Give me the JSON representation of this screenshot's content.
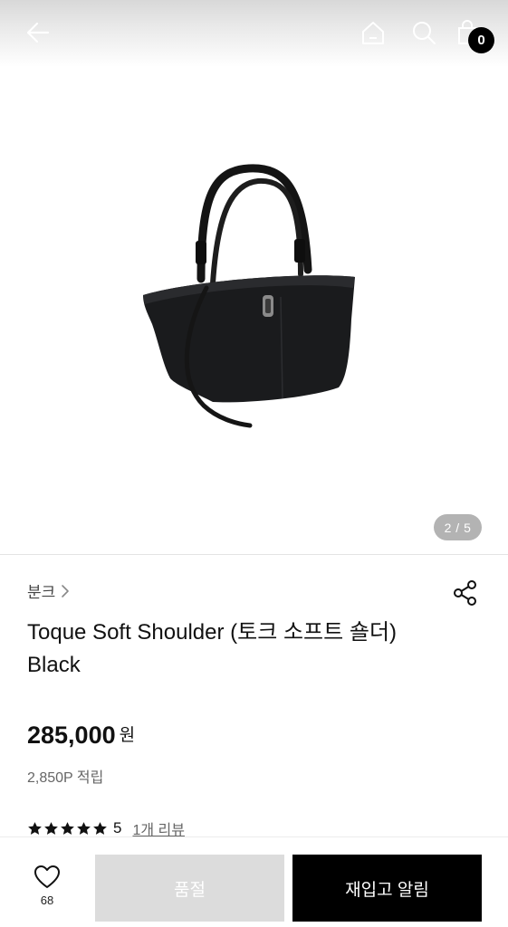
{
  "header": {
    "cart_count": "0",
    "icons": {
      "back": "arrow-left-icon",
      "home": "home-icon",
      "search": "search-icon",
      "cart": "shopping-bag-icon"
    }
  },
  "gallery": {
    "current": 2,
    "total": 5,
    "pager_label": "2 / 5"
  },
  "product": {
    "brand": "분크",
    "title_line1": "Toque Soft Shoulder (토크 소프트 숄더)",
    "title_line2": "Black",
    "price": "285,000",
    "currency": "원",
    "points": "2,850P 적립",
    "rating_stars": 5,
    "rating_value": "5",
    "review_count": "1개 리뷰"
  },
  "bottom_bar": {
    "like_count": "68",
    "soldout_label": "품절",
    "notify_label": "재입고 알림"
  },
  "colors": {
    "accent": "#000000",
    "pager_bg": "#b3b3b3",
    "soldout_bg": "#dcdcdc"
  }
}
